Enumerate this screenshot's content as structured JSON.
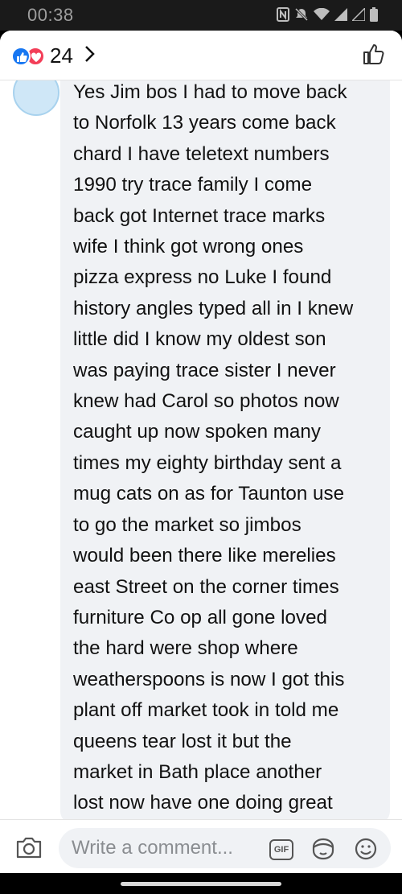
{
  "status_bar": {
    "time": "00:38",
    "icons": [
      "nfc-icon",
      "mute-icon",
      "wifi-icon",
      "signal-icon",
      "signal-icon",
      "battery-icon"
    ]
  },
  "header": {
    "reaction_icons": [
      "like-reaction-icon",
      "love-reaction-icon"
    ],
    "reaction_count": "24",
    "colors": {
      "like": "#1877f2",
      "love": "#f33e58"
    }
  },
  "comment": {
    "text": "Yes Jim bos I had to move back\nto Norfolk 13 years come back\nchard I have teletext numbers\n1990 try trace family I come\nback got Internet trace marks\nwife I think got wrong ones\npizza express no Luke I found\nhistory angles typed all in I knew\nlittle did I know my oldest son\nwas paying trace sister I never\nknew had Carol so photos now\ncaught up now spoken many\ntimes my eighty birthday sent a\nmug cats on as for Taunton use\nto go the market so jimbos\nwould been there like merelies\neast Street on the corner times\nfurniture Co op all gone loved\nthe hard were shop where\nweatherspoons is now I got this\nplant off market took in told me\nqueens tear lost it but the\nmarket in Bath place another\nlost now have one doing great"
  },
  "composer": {
    "placeholder": "Write a comment...",
    "value": "",
    "gif_label": "GIF"
  }
}
